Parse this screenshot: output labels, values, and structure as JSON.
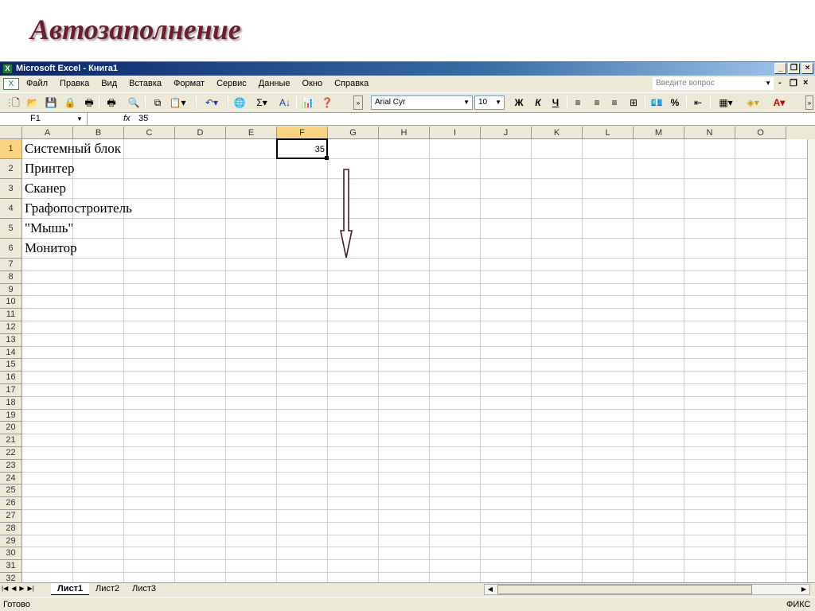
{
  "slide": {
    "title": "Автозаполнение"
  },
  "window": {
    "title": "Microsoft Excel - Книга1",
    "app_icon": "excel-icon"
  },
  "menu": {
    "items": [
      "Файл",
      "Правка",
      "Вид",
      "Вставка",
      "Формат",
      "Сервис",
      "Данные",
      "Окно",
      "Справка"
    ],
    "ask_placeholder": "Введите вопрос"
  },
  "toolbar": {
    "font_name": "Arial Cyr",
    "font_size": "10",
    "bold": "Ж",
    "italic": "К",
    "underline": "Ч",
    "percent": "%",
    "sum": "Σ"
  },
  "formula_bar": {
    "name_box": "F1",
    "fx": "fx",
    "formula": "35"
  },
  "grid": {
    "columns": [
      "A",
      "B",
      "C",
      "D",
      "E",
      "F",
      "G",
      "H",
      "I",
      "J",
      "K",
      "L",
      "M",
      "N",
      "O"
    ],
    "active_column": "F",
    "active_row": 1,
    "rows": [
      "1",
      "2",
      "3",
      "4",
      "5",
      "6",
      "7",
      "8",
      "9",
      "10",
      "11",
      "12",
      "13",
      "14",
      "15",
      "16",
      "17",
      "18",
      "19",
      "20",
      "21",
      "22",
      "23",
      "24",
      "25",
      "26",
      "27",
      "28",
      "29",
      "30",
      "31",
      "32"
    ],
    "a_column_values": [
      "Системный блок",
      "Принтер",
      "Сканер",
      "Графопостроитель",
      "\"Мышь\"",
      "Монитор"
    ],
    "f1_value": "35"
  },
  "sheets": {
    "tabs": [
      "Лист1",
      "Лист2",
      "Лист3"
    ],
    "active": "Лист1"
  },
  "status": {
    "left": "Готово",
    "right": "ФИКС"
  },
  "colors": {
    "title": "#6b1f2c",
    "titlebar": "#0a246a",
    "active_header": "#f8d380"
  }
}
